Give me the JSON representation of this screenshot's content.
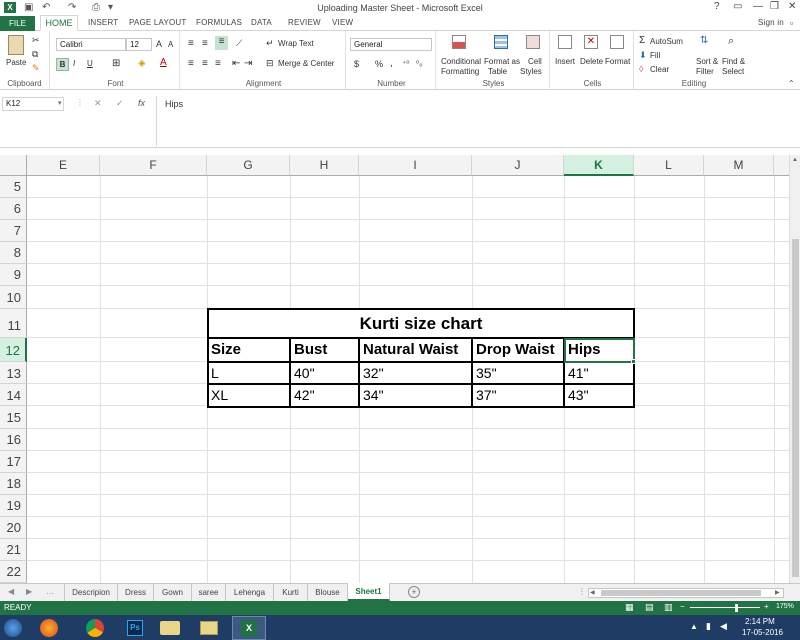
{
  "window": {
    "title": "Uploading Master Sheet - Microsoft Excel",
    "help": "?",
    "sign_in": "Sign in"
  },
  "ribbon_tabs": [
    "FILE",
    "HOME",
    "INSERT",
    "PAGE LAYOUT",
    "FORMULAS",
    "DATA",
    "REVIEW",
    "VIEW"
  ],
  "ribbon": {
    "clipboard": {
      "paste": "Paste",
      "label": "Clipboard"
    },
    "font": {
      "name": "Calibri",
      "size": "12",
      "label": "Font",
      "bold": "B",
      "italic": "I",
      "underline": "U"
    },
    "alignment": {
      "wrap": "Wrap Text",
      "merge": "Merge & Center",
      "label": "Alignment"
    },
    "number": {
      "format": "General",
      "currency": "$",
      "percent": "%",
      "comma": ",",
      "label": "Number"
    },
    "styles": {
      "conditional": "Conditional",
      "conditional2": "Formatting",
      "format_as": "Format as",
      "format_as2": "Table",
      "cell": "Cell",
      "cell2": "Styles",
      "label": "Styles"
    },
    "cells": {
      "insert": "Insert",
      "delete": "Delete",
      "format": "Format",
      "label": "Cells"
    },
    "editing": {
      "autosum": "AutoSum",
      "fill": "Fill",
      "clear": "Clear",
      "sort": "Sort &",
      "sort2": "Filter",
      "find": "Find &",
      "find2": "Select",
      "label": "Editing"
    }
  },
  "formula_bar": {
    "name_box": "K12",
    "fx": "fx",
    "content": "Hips"
  },
  "columns": [
    "E",
    "F",
    "G",
    "H",
    "I",
    "J",
    "K",
    "L",
    "M"
  ],
  "rows": [
    "5",
    "6",
    "7",
    "8",
    "9",
    "10",
    "11",
    "12",
    "13",
    "14",
    "15",
    "16",
    "17",
    "18",
    "19",
    "20",
    "21",
    "22"
  ],
  "sheet": {
    "title": "Kurti size chart",
    "headers": [
      "Size",
      "Bust",
      "Natural Waist",
      "Drop Waist",
      "Hips"
    ],
    "data": [
      [
        "L",
        "40\"",
        "32\"",
        "35\"",
        "41\""
      ],
      [
        "XL",
        "42\"",
        "34\"",
        "37\"",
        "43\""
      ]
    ]
  },
  "sheet_tabs": [
    "Descripion",
    "Dress",
    "Gown",
    "saree",
    "Lehenga",
    "Kurti",
    "Blouse",
    "Sheet1"
  ],
  "active_sheet": "Sheet1",
  "status": {
    "ready": "READY",
    "zoom": "175%"
  },
  "taskbar": {
    "time": "2:14 PM",
    "date": "17-05-2016"
  },
  "colors": {
    "excel_green": "#217346",
    "taskbar": "#1e3c64",
    "selected_header": "#d3f0e0"
  }
}
